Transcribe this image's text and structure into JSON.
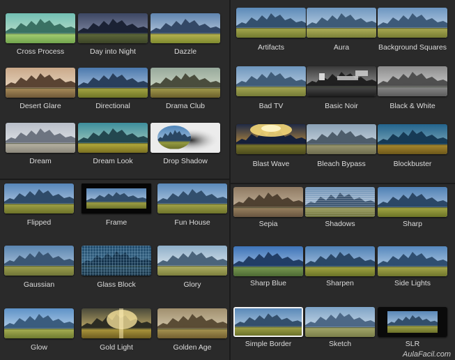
{
  "panels": [
    {
      "tiles": [
        {
          "label": "Cross Process",
          "icon": "cross-process-icon",
          "effect": "cross",
          "sky": "#6fbab6",
          "sky2": "#e9f2dc",
          "mtn": "#2b5c55",
          "field": "#b0cf68",
          "field2": "#6f9a3a"
        },
        {
          "label": "Day into Night",
          "icon": "day-into-night-icon",
          "effect": "plain",
          "sky": "#3d4763",
          "sky2": "#98a0b8",
          "mtn": "#1b2234",
          "field": "#606a3c",
          "field2": "#3c4427"
        },
        {
          "label": "Dazzle",
          "icon": "dazzle-icon",
          "effect": "plain",
          "sky": "#5f84ae",
          "sky2": "#d7e2ee",
          "mtn": "#334866",
          "field": "#b9b453",
          "field2": "#7f8a2e"
        },
        {
          "label": "Desert Glare",
          "icon": "desert-glare-icon",
          "effect": "plain",
          "sky": "#caa98a",
          "sky2": "#f1e5d2",
          "mtn": "#5a4433",
          "field": "#a98d5a",
          "field2": "#705838"
        },
        {
          "label": "Directional",
          "icon": "directional-icon",
          "effect": "plain",
          "sky": "#4b79ad",
          "sky2": "#c8d8ec",
          "mtn": "#293f5c",
          "field": "#a6a744",
          "field2": "#6f7527"
        },
        {
          "label": "Drama Club",
          "icon": "drama-club-icon",
          "effect": "plain",
          "sky": "#97a99b",
          "sky2": "#dfe6d2",
          "mtn": "#4a4d3d",
          "field": "#a39c4d",
          "field2": "#6b5f2b"
        },
        {
          "label": "Dream",
          "icon": "dream-icon",
          "effect": "plain",
          "sky": "#b8bec8",
          "sky2": "#eef0f2",
          "mtn": "#6d7480",
          "field": "#b8b4a4",
          "field2": "#8c887c"
        },
        {
          "label": "Dream Look",
          "icon": "dream-look-icon",
          "effect": "plain",
          "sky": "#3d8e9c",
          "sky2": "#c3dcc7",
          "mtn": "#23474f",
          "field": "#b6ae3c",
          "field2": "#7a7022"
        },
        {
          "label": "Drop Shadow",
          "icon": "drop-shadow-icon",
          "effect": "shadow",
          "sky": "#4e84b8",
          "sky2": "#c6d9ec",
          "mtn": "#2a4662",
          "field": "#9da345",
          "field2": "#6b7029"
        }
      ]
    },
    {
      "tiles": [
        {
          "label": "Artifacts",
          "icon": "artifacts-icon",
          "effect": "plain",
          "sky": "#5c8ab8",
          "sky2": "#c9dbeb",
          "mtn": "#33506e",
          "field": "#a6a94d",
          "field2": "#727a30"
        },
        {
          "label": "Aura",
          "icon": "aura-icon",
          "effect": "plain",
          "sky": "#6f97bf",
          "sky2": "#d8e5f1",
          "mtn": "#3e5b78",
          "field": "#b0b15a",
          "field2": "#7b8038"
        },
        {
          "label": "Background Squares",
          "icon": "background-squares-icon",
          "effect": "plain",
          "sky": "#6c95c0",
          "sky2": "#d9e6f3",
          "mtn": "#3d5a79",
          "field": "#aaaa52",
          "field2": "#777c33"
        },
        {
          "label": "Bad TV",
          "icon": "bad-tv-icon",
          "effect": "plain",
          "sky": "#6e96bd",
          "sky2": "#d3e1ee",
          "mtn": "#405c78",
          "field": "#a7a955",
          "field2": "#757b36"
        },
        {
          "label": "Basic Noir",
          "icon": "basic-noir-icon",
          "effect": "noir",
          "sky": "#3a3a3a",
          "sky2": "#b8b8b8",
          "mtn": "#202020",
          "field": "#4a4a4a",
          "field2": "#1e1e1e"
        },
        {
          "label": "Black & White",
          "icon": "black-white-icon",
          "effect": "plain",
          "sky": "#8c8c8c",
          "sky2": "#e4e4e4",
          "mtn": "#4f4f4f",
          "field": "#8a8a8a",
          "field2": "#5c5c5c"
        },
        {
          "label": "Blast Wave",
          "icon": "blast-wave-icon",
          "effect": "blast",
          "sky": "#1f2a46",
          "sky2": "#f4b23a",
          "mtn": "#15203a",
          "field": "#7f7a2e",
          "field2": "#4a4a1d"
        },
        {
          "label": "Bleach Bypass",
          "icon": "bleach-bypass-icon",
          "effect": "plain",
          "sky": "#8aa1b5",
          "sky2": "#e1e8ee",
          "mtn": "#4e5d6b",
          "field": "#9d9a71",
          "field2": "#6d6b4e"
        },
        {
          "label": "Blockbuster",
          "icon": "blockbuster-icon",
          "effect": "plain",
          "sky": "#23648d",
          "sky2": "#9ec1c9",
          "mtn": "#163a55",
          "field": "#a98a2e",
          "field2": "#6e581b"
        }
      ]
    },
    {
      "tiles": [
        {
          "label": "Flipped",
          "icon": "flipped-icon",
          "effect": "plain",
          "sky": "#5685b8",
          "sky2": "#cbdcee",
          "mtn": "#2f4b69",
          "field": "#a2a447",
          "field2": "#6c7229"
        },
        {
          "label": "Frame",
          "icon": "frame-icon",
          "effect": "frame",
          "sky": "#5a87b6",
          "sky2": "#cddced",
          "mtn": "#314d6a",
          "field": "#a2a347",
          "field2": "#6c722a"
        },
        {
          "label": "Fun House",
          "icon": "fun-house-icon",
          "effect": "plain",
          "sky": "#5a89ba",
          "sky2": "#cfdfef",
          "mtn": "#324f6d",
          "field": "#a5a64a",
          "field2": "#6e742b"
        },
        {
          "label": "Gaussian",
          "icon": "gaussian-icon",
          "effect": "plain",
          "sky": "#5a85b0",
          "sky2": "#c4d6e8",
          "mtn": "#3a5674",
          "field": "#9ea150",
          "field2": "#707537"
        },
        {
          "label": "Glass Block",
          "icon": "glass-block-icon",
          "effect": "glass",
          "sky": "#1f4a6b",
          "sky2": "#4f7c99",
          "mtn": "#15344d",
          "field": "#2a4f66",
          "field2": "#173245"
        },
        {
          "label": "Glory",
          "icon": "glory-icon",
          "effect": "plain",
          "sky": "#8fafc9",
          "sky2": "#f2f6f8",
          "mtn": "#4b647b",
          "field": "#b2b266",
          "field2": "#7c7f3d"
        },
        {
          "label": "Glow",
          "icon": "glow-icon",
          "effect": "plain",
          "sky": "#5e92c7",
          "sky2": "#d8e8f6",
          "mtn": "#3a5c7e",
          "field": "#a8b254",
          "field2": "#6f7b30"
        },
        {
          "label": "Gold Light",
          "icon": "gold-light-icon",
          "effect": "gold",
          "sky": "#4a4a3a",
          "sky2": "#f0d27a",
          "mtn": "#2c2c22",
          "field": "#b09a3e",
          "field2": "#6e5d20"
        },
        {
          "label": "Golden Age",
          "icon": "golden-age-icon",
          "effect": "plain",
          "sky": "#a08f6e",
          "sky2": "#e6dcc2",
          "mtn": "#5a4c35",
          "field": "#a89552",
          "field2": "#735f30"
        }
      ]
    },
    {
      "tiles": [
        {
          "label": "Sepia",
          "icon": "sepia-icon",
          "effect": "plain",
          "sky": "#8f7a62",
          "sky2": "#d6c7b0",
          "mtn": "#4f4131",
          "field": "#9a8360",
          "field2": "#685540"
        },
        {
          "label": "Shadows",
          "icon": "shadows-icon",
          "effect": "lines",
          "sky": "#6b8fb3",
          "sky2": "#d1ddea",
          "mtn": "#3f5874",
          "field": "#9b9d5a",
          "field2": "#6a6e3a"
        },
        {
          "label": "Sharp",
          "icon": "sharp-icon",
          "effect": "plain",
          "sky": "#4f80b4",
          "sky2": "#c8daee",
          "mtn": "#2b4766",
          "field": "#a5a845",
          "field2": "#6c7427"
        },
        {
          "label": "Sharp Blue",
          "icon": "sharp-blue-icon",
          "effect": "plain",
          "sky": "#3e74b8",
          "sky2": "#bed4f0",
          "mtn": "#213d66",
          "field": "#7b9b52",
          "field2": "#4d6a34"
        },
        {
          "label": "Sharpen",
          "icon": "sharpen-icon",
          "effect": "plain",
          "sky": "#4e80b5",
          "sky2": "#c7d9ee",
          "mtn": "#2a4767",
          "field": "#a4a744",
          "field2": "#6b7327"
        },
        {
          "label": "Side Lights",
          "icon": "side-lights-icon",
          "effect": "plain",
          "sky": "#5688bd",
          "sky2": "#cfe0f1",
          "mtn": "#2f4e70",
          "field": "#a9aa4c",
          "field2": "#70762c"
        },
        {
          "label": "Simple Border",
          "icon": "simple-border-icon",
          "effect": "border",
          "sky": "#5a89b8",
          "sky2": "#cfdfee",
          "mtn": "#334f6c",
          "field": "#a3a549",
          "field2": "#6c722b"
        },
        {
          "label": "Sketch",
          "icon": "sketch-icon",
          "effect": "plain",
          "sky": "#7ea3c6",
          "sky2": "#e4edf5",
          "mtn": "#4d6886",
          "field": "#a5a86a",
          "field2": "#7a7e4a"
        },
        {
          "label": "SLR",
          "icon": "slr-icon",
          "effect": "slr",
          "sky": "#5a88b7",
          "sky2": "#cddeef",
          "mtn": "#324e6b",
          "field": "#a2a448",
          "field2": "#6b712a"
        }
      ]
    }
  ],
  "watermark": "AulaFacil.com"
}
